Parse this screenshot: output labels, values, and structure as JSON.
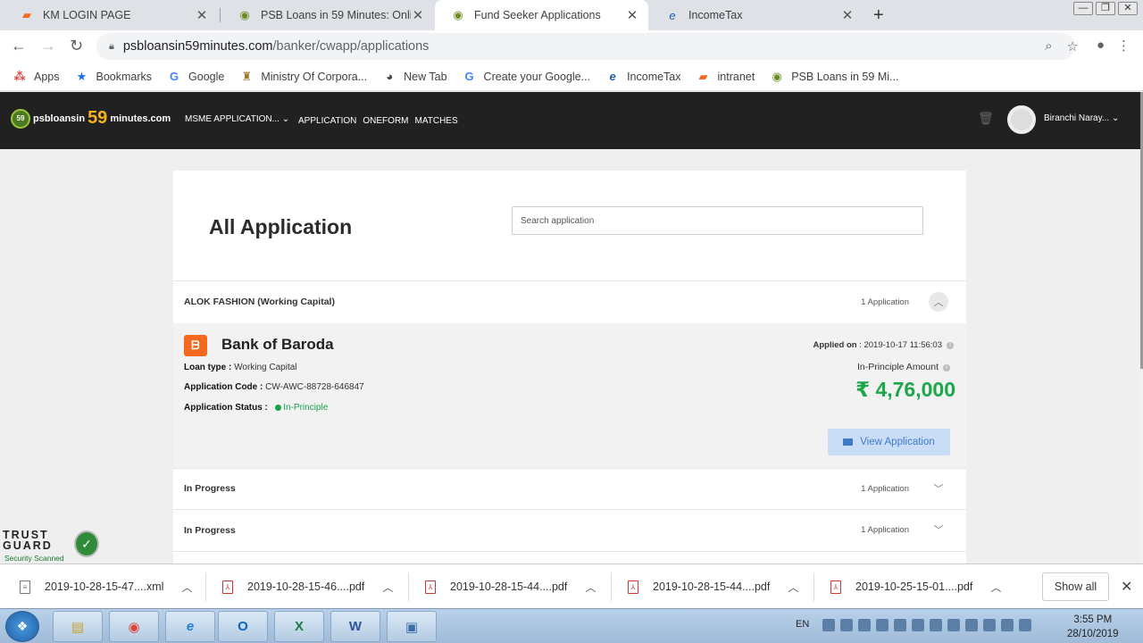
{
  "browser": {
    "tabs": [
      {
        "title": "KM LOGIN PAGE",
        "icon": "bob-favicon-icon"
      },
      {
        "title": "PSB Loans in 59 Minutes: Online",
        "icon": "psb-favicon-icon"
      },
      {
        "title": "Fund Seeker Applications",
        "icon": "psb-favicon-icon"
      },
      {
        "title": "IncomeTax",
        "icon": "ie-favicon-icon"
      }
    ],
    "url_domain": "psbloansin59minutes.com",
    "url_path": "/banker/cwapp/applications",
    "bookmarks": [
      "Apps",
      "Bookmarks",
      "Google",
      "Ministry Of Corpora...",
      "New Tab",
      "Create your Google...",
      "IncomeTax",
      "intranet",
      "PSB Loans in 59 Mi..."
    ]
  },
  "site": {
    "logo_left": "psbloansin",
    "logo_num": "59",
    "logo_right": "minutes.com",
    "logo_badge": "59",
    "msme_menu": "MSME APPLICATION...",
    "nav": [
      "APPLICATION",
      "ONEFORM",
      "MATCHES"
    ],
    "user_name": "Biranchi Naray..."
  },
  "page": {
    "title": "All Application",
    "search_placeholder": "Search application",
    "group1": {
      "title": "ALOK FASHION (Working Capital)",
      "count": "1 Application"
    },
    "application": {
      "bank": "Bank of Baroda",
      "loan_type_label": "Loan type :",
      "loan_type": "Working Capital",
      "code_label": "Application Code :",
      "code": "CW-AWC-88728-646847",
      "status_label": "Application Status :",
      "status": "In-Principle",
      "applied_label": "Applied on",
      "applied_on": ": 2019-10-17 11:56:03",
      "amount_label": "In-Principle Amount",
      "amount": "₹ 4,76,000",
      "view_button": "View Application"
    },
    "group2": {
      "title": "In Progress",
      "count": "1 Application"
    },
    "group3": {
      "title": "In Progress",
      "count": "1 Application"
    }
  },
  "trustguard": {
    "title_line1": "TRUST",
    "title_line2": "GUARD",
    "subtitle": "Security Scanned"
  },
  "downloads": {
    "items": [
      "2019-10-28-15-47....xml",
      "2019-10-28-15-46....pdf",
      "2019-10-28-15-44....pdf",
      "2019-10-28-15-44....pdf",
      "2019-10-25-15-01....pdf"
    ],
    "show_all": "Show all"
  },
  "taskbar": {
    "lang": "EN",
    "time": "3:55 PM",
    "date": "28/10/2019"
  },
  "colors": {
    "header_bg": "#212121",
    "amount_green": "#1aa84a",
    "status_green": "#16a34a",
    "view_btn_bg": "#c9def6",
    "logo_orange": "#f6b21a"
  }
}
